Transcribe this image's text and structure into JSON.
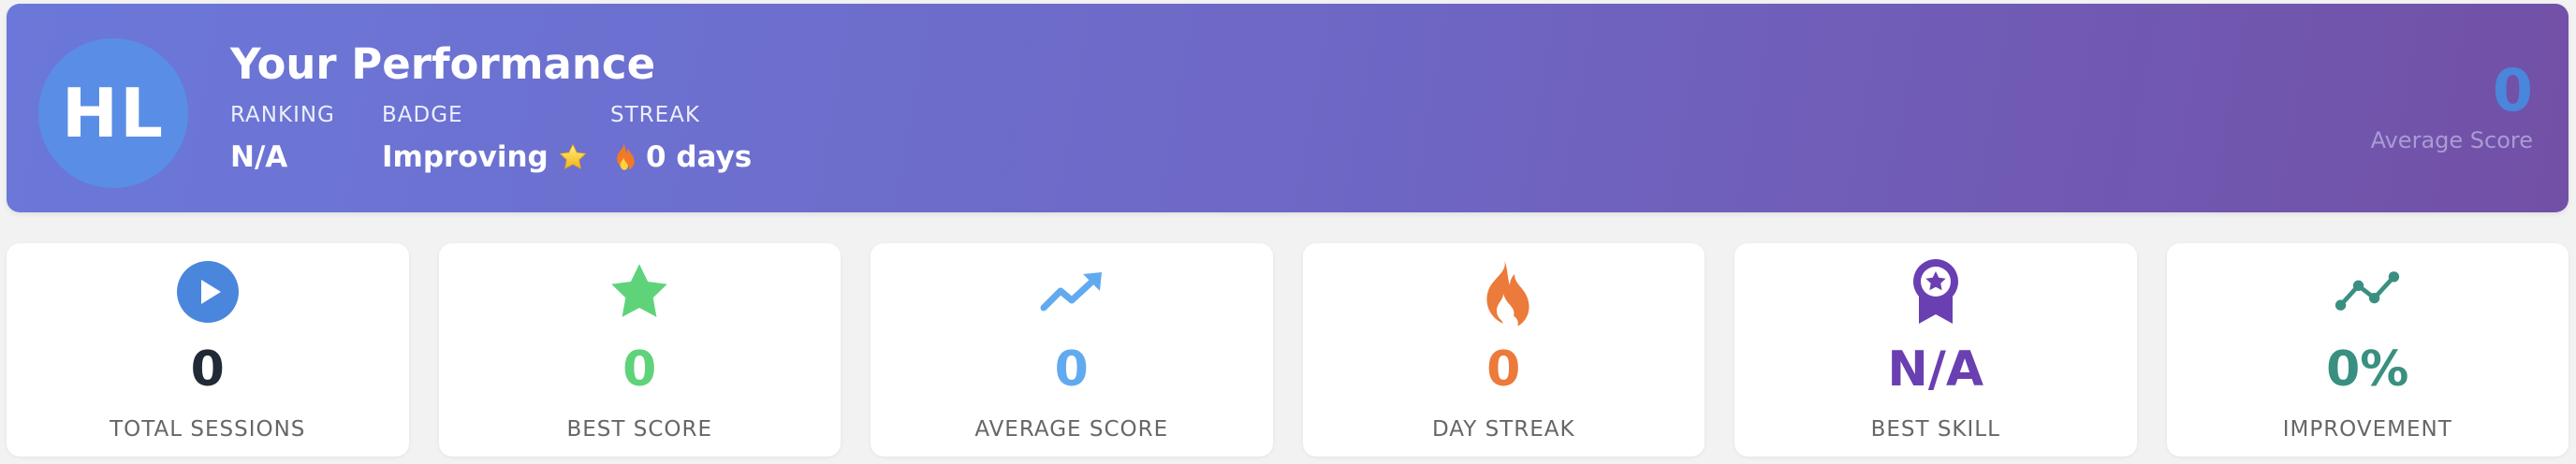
{
  "header": {
    "initials": "HL",
    "title": "Your Performance",
    "ranking_label": "RANKING",
    "ranking_value": "N/A",
    "badge_label": "BADGE",
    "badge_value": "Improving",
    "streak_label": "STREAK",
    "streak_value": "0 days",
    "average_value": "0",
    "average_label": "Average Score"
  },
  "colors": {
    "accent_blue": "#4a86dc",
    "sessions": "#222a38",
    "best_score": "#5fd37a",
    "average": "#62aaf0",
    "streak": "#ec7a3a",
    "skill": "#6a3fb1",
    "improvement": "#3a9080"
  },
  "stats": [
    {
      "icon": "play-circle-icon",
      "value": "0",
      "label": "TOTAL SESSIONS"
    },
    {
      "icon": "star-icon",
      "value": "0",
      "label": "BEST SCORE"
    },
    {
      "icon": "trending-up-icon",
      "value": "0",
      "label": "AVERAGE SCORE"
    },
    {
      "icon": "fire-icon",
      "value": "0",
      "label": "DAY STREAK"
    },
    {
      "icon": "award-ribbon-icon",
      "value": "N/A",
      "label": "BEST SKILL"
    },
    {
      "icon": "line-chart-icon",
      "value": "0%",
      "label": "IMPROVEMENT"
    }
  ]
}
